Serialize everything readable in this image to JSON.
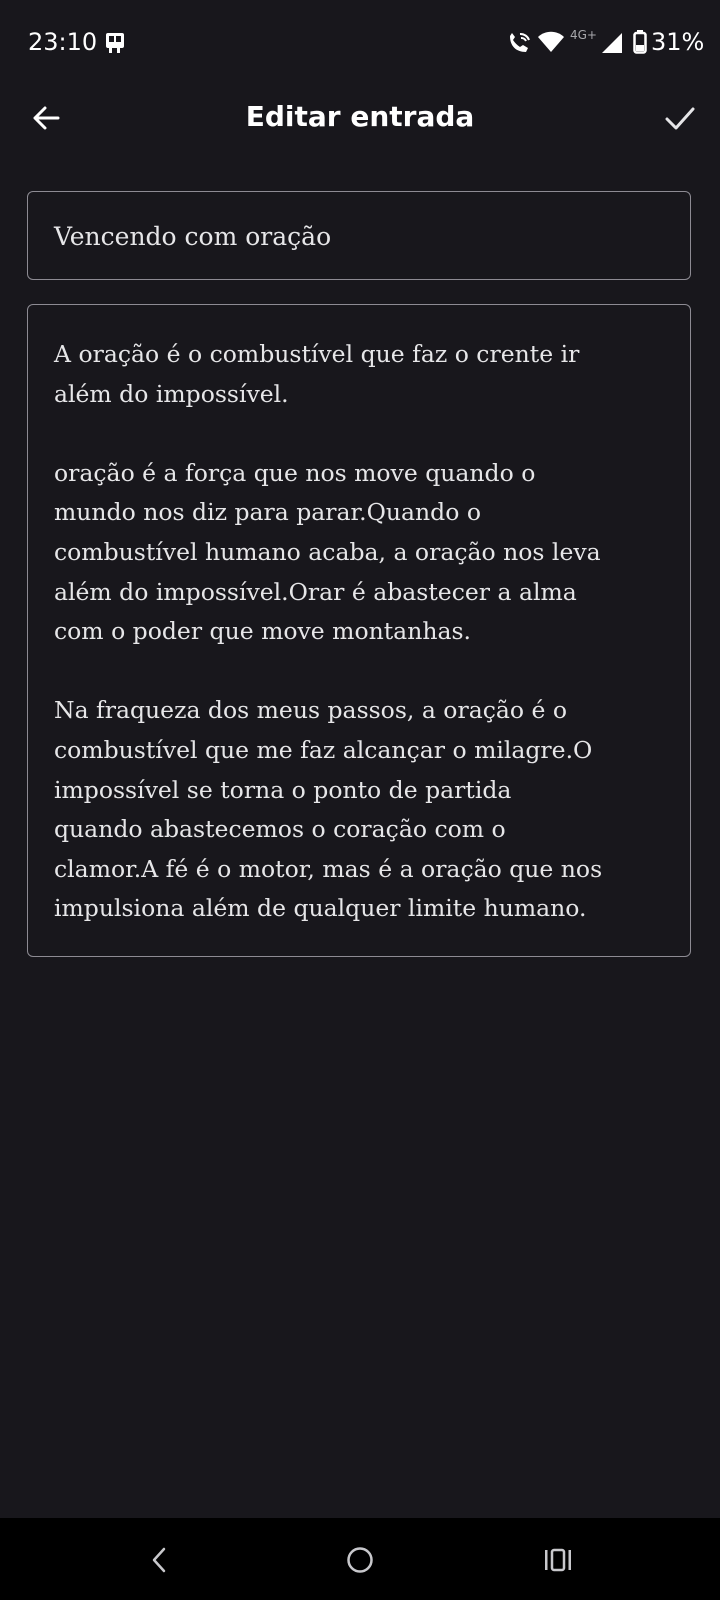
{
  "status_bar": {
    "time": "23:10",
    "network_label": "4G+",
    "battery": "31%",
    "icons": [
      "notification-app-icon",
      "wifi-calling-icon",
      "wifi-icon",
      "cell-signal-icon",
      "battery-icon"
    ]
  },
  "app_bar": {
    "title": "Editar entrada",
    "back_icon": "arrow-left-icon",
    "confirm_icon": "check-icon"
  },
  "entry": {
    "title": "Vencendo com oração",
    "body_lines": [
      "A oração é o combustível que faz o crente ir",
      "além do impossível.",
      "",
      "oração é a força que nos move quando o",
      "mundo nos diz para parar.Quando o",
      "combustível humano acaba, a oração nos leva",
      "além do impossível.Orar é abastecer a alma",
      "com o poder que move montanhas.",
      "",
      "Na fraqueza dos meus passos, a oração é o",
      "combustível que me faz alcançar o milagre.O",
      "impossível se torna o ponto de partida",
      "quando abastecemos o coração com o",
      "clamor.A fé é o motor, mas é a oração que nos",
      "impulsiona além de qualquer limite humano."
    ]
  },
  "nav_bar": {
    "icons": [
      "nav-back-icon",
      "nav-home-icon",
      "nav-recents-icon"
    ]
  },
  "colors": {
    "background": "#18171c",
    "field_border": "#8d8b93",
    "text": "#e6e6e8",
    "nav_background": "#000000"
  }
}
